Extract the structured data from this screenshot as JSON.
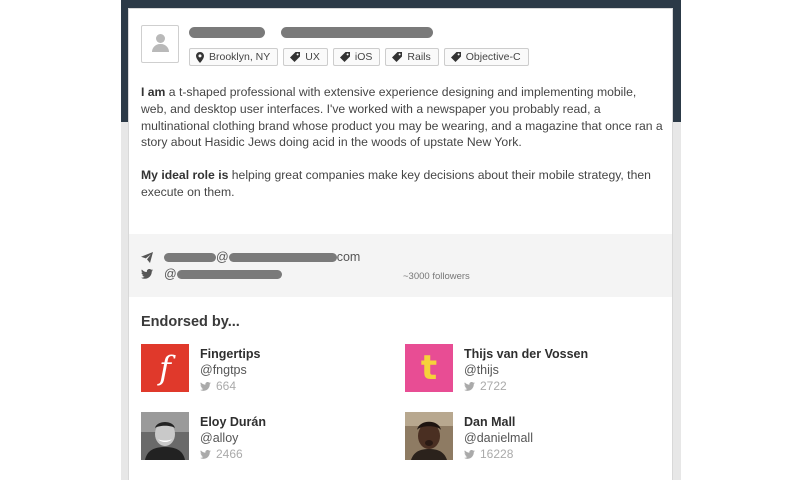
{
  "profile": {
    "tags": [
      {
        "icon": "location-pin-icon",
        "label": "Brooklyn, NY"
      },
      {
        "icon": "tag-icon",
        "label": "UX"
      },
      {
        "icon": "tag-icon",
        "label": "iOS"
      },
      {
        "icon": "tag-icon",
        "label": "Rails"
      },
      {
        "icon": "tag-icon",
        "label": "Objective-C"
      }
    ],
    "bio": {
      "p1_lead": "I am",
      "p1_text": " a t-shaped professional with extensive experience designing and implementing mobile, web, and desktop user interfaces. I've worked with a newspaper you probably read, a multinational clothing brand whose product you may be wearing, and a magazine that once ran a story about Hasidic Jews doing acid in the woods of upstate New York.",
      "p2_lead": "My ideal role is",
      "p2_text": " helping great companies make key decisions about their mobile strategy, then execute on them."
    }
  },
  "contact": {
    "email_at": "@",
    "email_suffix": "com",
    "twitter_at": "@",
    "followers": "~3000 followers"
  },
  "endorsements": {
    "title": "Endorsed by...",
    "items": [
      {
        "name": "Fingertips",
        "handle": "@fngtps",
        "count": "664",
        "logo_letter": "f",
        "logo_bg": "#e0392b"
      },
      {
        "name": "Thijs van der Vossen",
        "handle": "@thijs",
        "count": "2722",
        "logo_letter": "t",
        "logo_bg": "#e84d94"
      },
      {
        "name": "Eloy Durán",
        "handle": "@alloy",
        "count": "2466"
      },
      {
        "name": "Dan Mall",
        "handle": "@danielmall",
        "count": "16228"
      }
    ]
  },
  "colors": {
    "header_bg": "#2c3a47",
    "page_bg": "#e7e7e7",
    "twitter_icon": "#aaaaaa"
  }
}
